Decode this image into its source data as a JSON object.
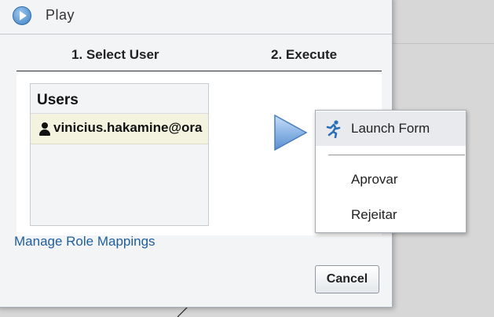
{
  "dialog": {
    "title": "Play",
    "steps": [
      "1. Select User",
      "2. Execute"
    ],
    "users": {
      "header": "Users",
      "items": [
        {
          "name": "vinicius.hakamine@ora"
        }
      ]
    },
    "manage_link": "Manage Role Mappings",
    "cancel_label": "Cancel"
  },
  "menu": {
    "items": [
      {
        "label": "Launch Form",
        "icon": "run-icon"
      },
      {
        "label": "Aprovar"
      },
      {
        "label": "Rejeitar"
      }
    ]
  },
  "colors": {
    "link": "#1f5f9c",
    "accent": "#3e7fc4",
    "selected_row": "#f4f3df"
  }
}
